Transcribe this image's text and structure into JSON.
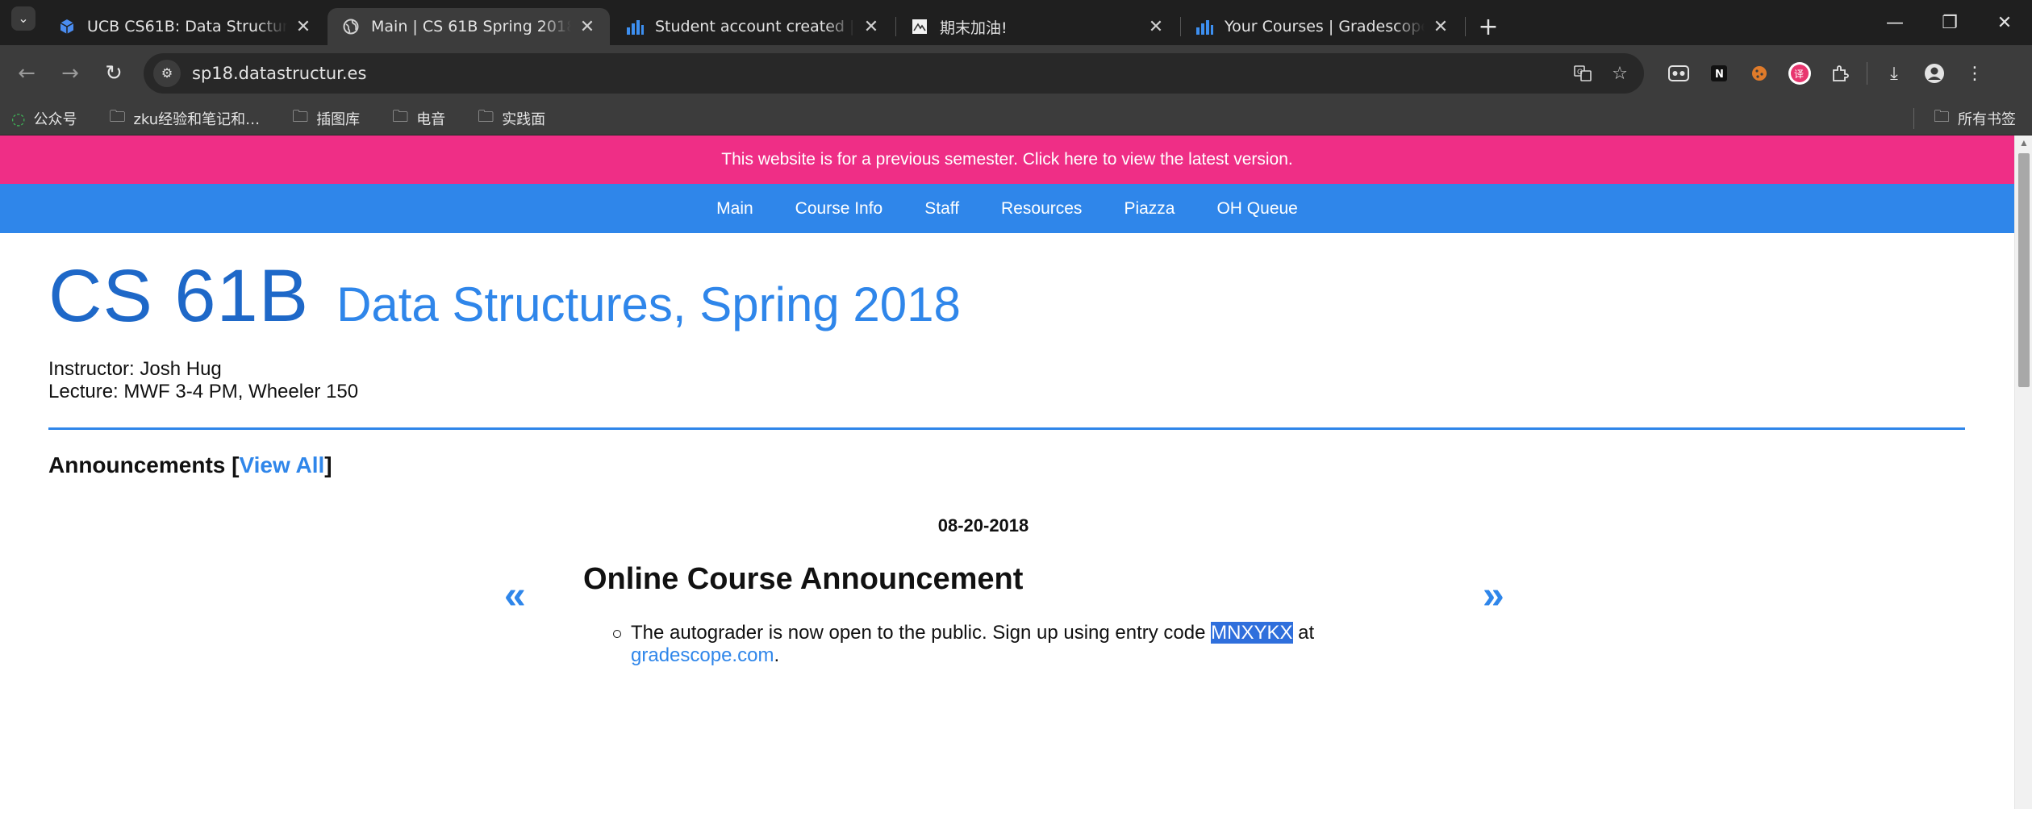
{
  "browser": {
    "tabs": [
      {
        "title": "UCB CS61B: Data Structures",
        "icon": "cube-icon",
        "active": false
      },
      {
        "title": "Main | CS 61B Spring 2018",
        "icon": "globe-icon",
        "active": true
      },
      {
        "title": "Student account created | Gradescope",
        "icon": "bar-chart-icon",
        "active": false
      },
      {
        "title": "期末加油!",
        "icon": "image-icon",
        "active": false
      },
      {
        "title": "Your Courses | Gradescope",
        "icon": "bar-chart-icon",
        "active": false
      }
    ],
    "url": "sp18.datastructur.es",
    "bookmarks": [
      "公众号",
      "zku经验和笔记和…",
      "插图库",
      "电音",
      "实践面"
    ],
    "all_bookmarks": "所有书签"
  },
  "banner": {
    "text": "This website is for a previous semester. Click here to view the latest version."
  },
  "nav": {
    "items": [
      "Main",
      "Course Info",
      "Staff",
      "Resources",
      "Piazza",
      "OH Queue"
    ]
  },
  "header": {
    "course": "CS 61B",
    "subtitle": "Data Structures, Spring 2018",
    "instructor": "Instructor: Josh Hug",
    "lecture": "Lecture: MWF 3-4 PM, Wheeler 150"
  },
  "announcements": {
    "heading": "Announcements",
    "view_all": "View All",
    "prev": "«",
    "next": "»",
    "date": "08-20-2018",
    "title": "Online Course Announcement",
    "body_before": "The autograder is now open to the public. Sign up using entry code ",
    "code": "MNXYKX",
    "body_after": " at ",
    "link": "gradescope.com",
    "period": "."
  },
  "colors": {
    "banner": "#ef2e86",
    "nav": "#2f86ea",
    "heading": "#1e68c8"
  }
}
